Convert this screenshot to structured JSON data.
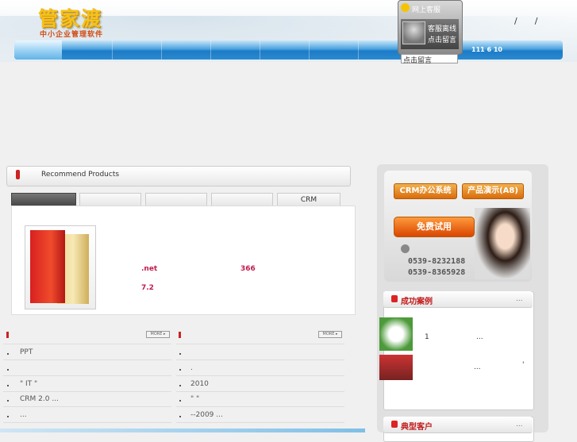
{
  "header": {
    "logo_main": "管家渡",
    "logo_sub": "中小企业管理软件",
    "top_links": [
      "/",
      "/"
    ],
    "nav_date": "111 6 10"
  },
  "chat": {
    "title": "网上客服",
    "status": "客服离线",
    "leave_message": "点击留言",
    "footer_link": "点击留言"
  },
  "recommend": {
    "title": "Recommend Products",
    "tabs": [
      "",
      "",
      "",
      "",
      "CRM"
    ],
    "product_text": {
      "net": ".net",
      "n366": "366",
      "v72": "7.2"
    }
  },
  "news_left": {
    "more": "MORE ▸",
    "items": [
      "PPT",
      "",
      "\" IT    \"",
      "CRM  2.0      ...",
      "          ..."
    ]
  },
  "news_right": {
    "more": "MORE ▸",
    "items": [
      "",
      ".",
      "2010",
      "     \"  \"",
      "      --2009     ..."
    ]
  },
  "sidebar": {
    "btn_crm": "CRM办公系统",
    "btn_demo": "产品演示(A8)",
    "btn_trial": "免费试用",
    "phone1": "0539-8232188",
    "phone2": "0539-8365928",
    "cases_title": "成功案例",
    "case_1": "1",
    "case_dots1": "...",
    "case_dots2": "...",
    "case_tick": "'",
    "clients_title": "典型客户",
    "head_dots": "..."
  },
  "colors": {
    "nav_blue": "#1d7bc7",
    "accent_red": "#c21a4f",
    "button_orange": "#d96c0c"
  }
}
